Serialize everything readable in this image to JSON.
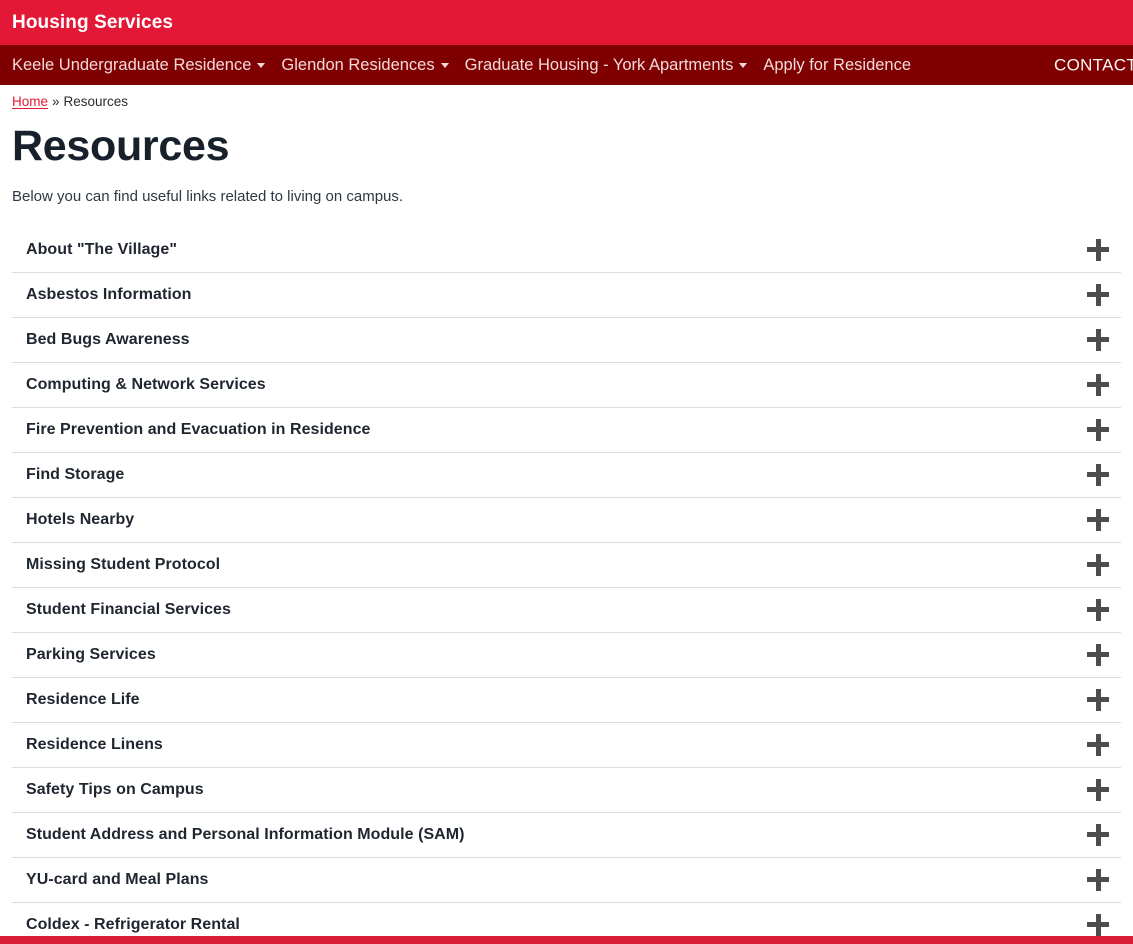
{
  "brand": {
    "title": "Housing Services",
    "bar_color": "#e31837"
  },
  "nav": {
    "bar_color": "#7f0000",
    "items": [
      {
        "label": "Keele Undergraduate Residence",
        "has_dropdown": true
      },
      {
        "label": "Glendon Residences",
        "has_dropdown": true
      },
      {
        "label": "Graduate Housing - York Apartments",
        "has_dropdown": true
      },
      {
        "label": "Apply for Residence",
        "has_dropdown": false
      }
    ],
    "contact_label": "CONTACT"
  },
  "breadcrumb": {
    "home_label": "Home",
    "separator": "»",
    "current_label": "Resources"
  },
  "page": {
    "title": "Resources",
    "description": "Below you can find useful links related to living on campus."
  },
  "accordion": {
    "expand_icon": "plus-icon",
    "items": [
      {
        "label": "About \"The Village\""
      },
      {
        "label": "Asbestos Information"
      },
      {
        "label": "Bed Bugs Awareness"
      },
      {
        "label": "Computing & Network Services"
      },
      {
        "label": "Fire Prevention and Evacuation in Residence"
      },
      {
        "label": "Find Storage"
      },
      {
        "label": "Hotels Nearby"
      },
      {
        "label": "Missing Student Protocol"
      },
      {
        "label": "Student Financial Services"
      },
      {
        "label": "Parking Services"
      },
      {
        "label": "Residence Life"
      },
      {
        "label": "Residence Linens"
      },
      {
        "label": "Safety Tips on Campus"
      },
      {
        "label": "Student Address and Personal Information Module (SAM)"
      },
      {
        "label": "YU-card and Meal Plans"
      },
      {
        "label": "Coldex - Refrigerator Rental"
      }
    ]
  },
  "footer": {
    "bar_color": "#d91c37"
  }
}
